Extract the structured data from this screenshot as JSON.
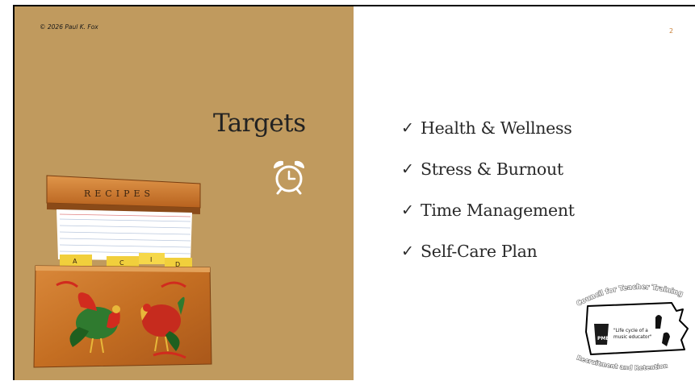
{
  "slide": {
    "copyright": "© 2026 Paul K. Fox",
    "title": "Targets",
    "page_number": "2",
    "bullets": [
      {
        "check": "✓",
        "text": "Health & Wellness"
      },
      {
        "check": "✓",
        "text": "Stress & Burnout"
      },
      {
        "check": "✓",
        "text": "Time Management"
      },
      {
        "check": "✓",
        "text": "Self-Care Plan"
      }
    ]
  },
  "recipe_box": {
    "label": "RECIPES",
    "tabs": [
      "A",
      "C",
      "I",
      "D"
    ]
  },
  "logo": {
    "top_text": "Council for Teacher Training",
    "inner_text_line1": "\"Life cycle of a",
    "inner_text_line2": "music educator\"",
    "badge_text": "PMEA",
    "bottom_text": "Recruitment and Retention"
  },
  "icons": {
    "clock": "alarm-clock-icon",
    "check": "check-icon"
  },
  "colors": {
    "left_panel": "#c09a5e",
    "page_number": "#c8813a",
    "text": "#2a2a2a"
  }
}
